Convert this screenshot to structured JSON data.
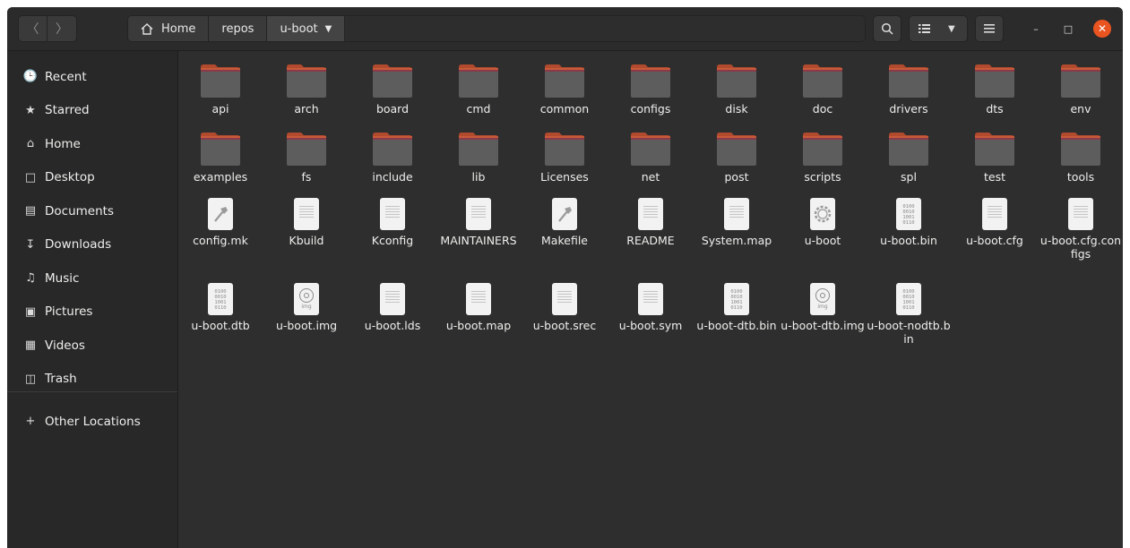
{
  "header": {
    "back_icon": "chevron-left",
    "forward_icon": "chevron-right",
    "breadcrumbs": [
      "Home",
      "repos",
      "u-boot"
    ],
    "search_icon": "search-icon",
    "view_icon": "list-view-icon",
    "menu_icon": "hamburger-icon",
    "window_controls": {
      "minimize": "–",
      "maximize": "□",
      "close": "✕"
    },
    "accent_color": "#e95420"
  },
  "sidebar": {
    "items": [
      {
        "label": "Recent",
        "icon": "clock-icon"
      },
      {
        "label": "Starred",
        "icon": "star-icon"
      },
      {
        "label": "Home",
        "icon": "home-icon"
      },
      {
        "label": "Desktop",
        "icon": "desktop-icon"
      },
      {
        "label": "Documents",
        "icon": "documents-icon"
      },
      {
        "label": "Downloads",
        "icon": "download-icon"
      },
      {
        "label": "Music",
        "icon": "music-icon"
      },
      {
        "label": "Pictures",
        "icon": "pictures-icon"
      },
      {
        "label": "Videos",
        "icon": "videos-icon"
      },
      {
        "label": "Trash",
        "icon": "trash-icon"
      }
    ],
    "other_locations": "Other Locations"
  },
  "files": [
    {
      "name": "api",
      "type": "folder"
    },
    {
      "name": "arch",
      "type": "folder"
    },
    {
      "name": "board",
      "type": "folder"
    },
    {
      "name": "cmd",
      "type": "folder"
    },
    {
      "name": "common",
      "type": "folder"
    },
    {
      "name": "configs",
      "type": "folder"
    },
    {
      "name": "disk",
      "type": "folder"
    },
    {
      "name": "doc",
      "type": "folder"
    },
    {
      "name": "drivers",
      "type": "folder"
    },
    {
      "name": "dts",
      "type": "folder"
    },
    {
      "name": "env",
      "type": "folder"
    },
    {
      "name": "examples",
      "type": "folder"
    },
    {
      "name": "fs",
      "type": "folder"
    },
    {
      "name": "include",
      "type": "folder"
    },
    {
      "name": "lib",
      "type": "folder"
    },
    {
      "name": "Licenses",
      "type": "folder"
    },
    {
      "name": "net",
      "type": "folder"
    },
    {
      "name": "post",
      "type": "folder"
    },
    {
      "name": "scripts",
      "type": "folder"
    },
    {
      "name": "spl",
      "type": "folder"
    },
    {
      "name": "test",
      "type": "folder"
    },
    {
      "name": "tools",
      "type": "folder"
    },
    {
      "name": "config.mk",
      "type": "makefile"
    },
    {
      "name": "Kbuild",
      "type": "text"
    },
    {
      "name": "Kconfig",
      "type": "text"
    },
    {
      "name": "MAINTAINERS",
      "type": "text"
    },
    {
      "name": "Makefile",
      "type": "makefile"
    },
    {
      "name": "README",
      "type": "text"
    },
    {
      "name": "System.map",
      "type": "text"
    },
    {
      "name": "u-boot",
      "type": "executable"
    },
    {
      "name": "u-boot.bin",
      "type": "binary"
    },
    {
      "name": "u-boot.cfg",
      "type": "text"
    },
    {
      "name": "u-boot.cfg.configs",
      "type": "text"
    },
    {
      "name": "u-boot.dtb",
      "type": "binary"
    },
    {
      "name": "u-boot.img",
      "type": "disc"
    },
    {
      "name": "u-boot.lds",
      "type": "text"
    },
    {
      "name": "u-boot.map",
      "type": "text"
    },
    {
      "name": "u-boot.srec",
      "type": "text"
    },
    {
      "name": "u-boot.sym",
      "type": "text"
    },
    {
      "name": "u-boot-dtb.bin",
      "type": "binary"
    },
    {
      "name": "u-boot-dtb.img",
      "type": "disc"
    },
    {
      "name": "u-boot-nodtb.bin",
      "type": "binary"
    }
  ],
  "icon_glyphs": {
    "binary": [
      "0100",
      "0010",
      "1001",
      "0110"
    ],
    "disc_tag": "img"
  }
}
